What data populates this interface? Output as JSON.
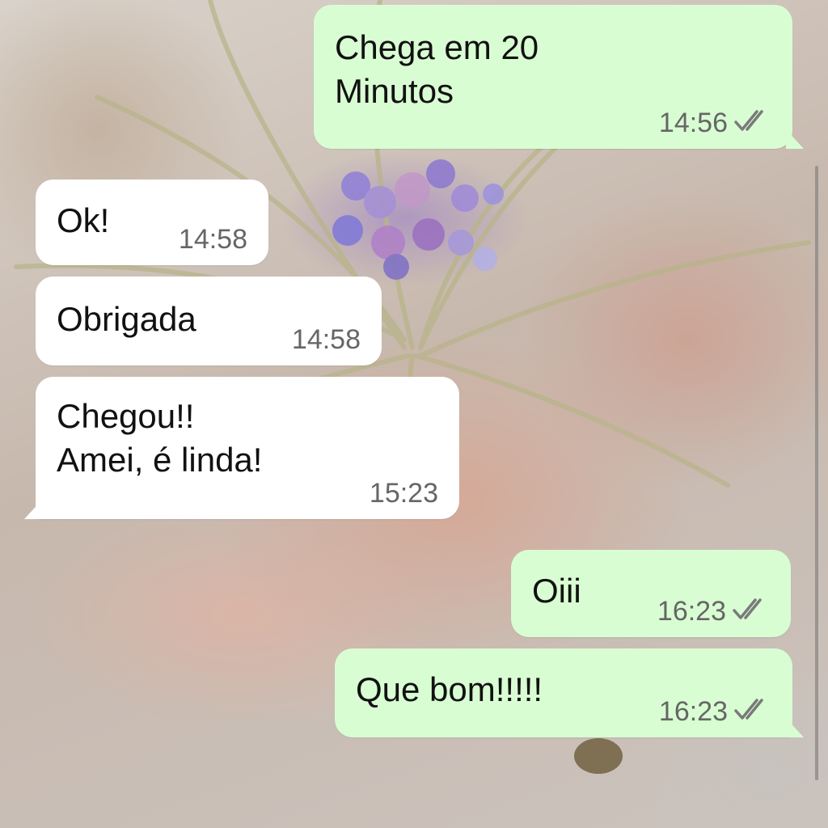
{
  "chat": {
    "messages": [
      {
        "direction": "outgoing",
        "text": "Chega em 20\nMinutos",
        "time": "14:56",
        "status": "double-check-icon"
      },
      {
        "direction": "incoming",
        "text": "Ok!",
        "time": "14:58"
      },
      {
        "direction": "incoming",
        "text": "Obrigada",
        "time": "14:58"
      },
      {
        "direction": "incoming",
        "text": "Chegou!!\nAmei, é linda!",
        "time": "15:23"
      },
      {
        "direction": "outgoing",
        "text": "Oiii",
        "time": "16:23",
        "status": "double-check-icon"
      },
      {
        "direction": "outgoing",
        "text": "Que bom!!!!!",
        "time": "16:23",
        "status": "double-check-icon"
      }
    ]
  },
  "colors": {
    "incoming_bubble": "#ffffff",
    "outgoing_bubble": "#d9fdd3",
    "timestamp": "#666666"
  }
}
